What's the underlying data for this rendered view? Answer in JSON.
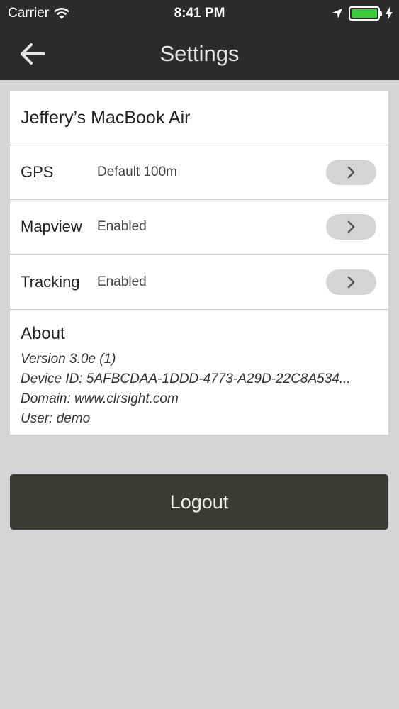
{
  "status": {
    "carrier": "Carrier",
    "time": "8:41 PM"
  },
  "nav": {
    "title": "Settings"
  },
  "device": {
    "name": "Jeffery’s MacBook Air"
  },
  "settings": [
    {
      "label": "GPS",
      "value": "Default 100m"
    },
    {
      "label": "Mapview",
      "value": "Enabled"
    },
    {
      "label": "Tracking",
      "value": "Enabled"
    }
  ],
  "about": {
    "title": "About",
    "version": "Version 3.0e (1)",
    "device_id": "Device ID: 5AFBCDAA-1DDD-4773-A29D-22C8A534...",
    "domain": "Domain: www.clrsight.com",
    "user": "User: demo"
  },
  "logout": {
    "label": "Logout"
  },
  "colors": {
    "header": "#2c2c2c",
    "background": "#d4d3d5",
    "logout_button": "#3c3a35",
    "battery": "#3ccb3c"
  }
}
